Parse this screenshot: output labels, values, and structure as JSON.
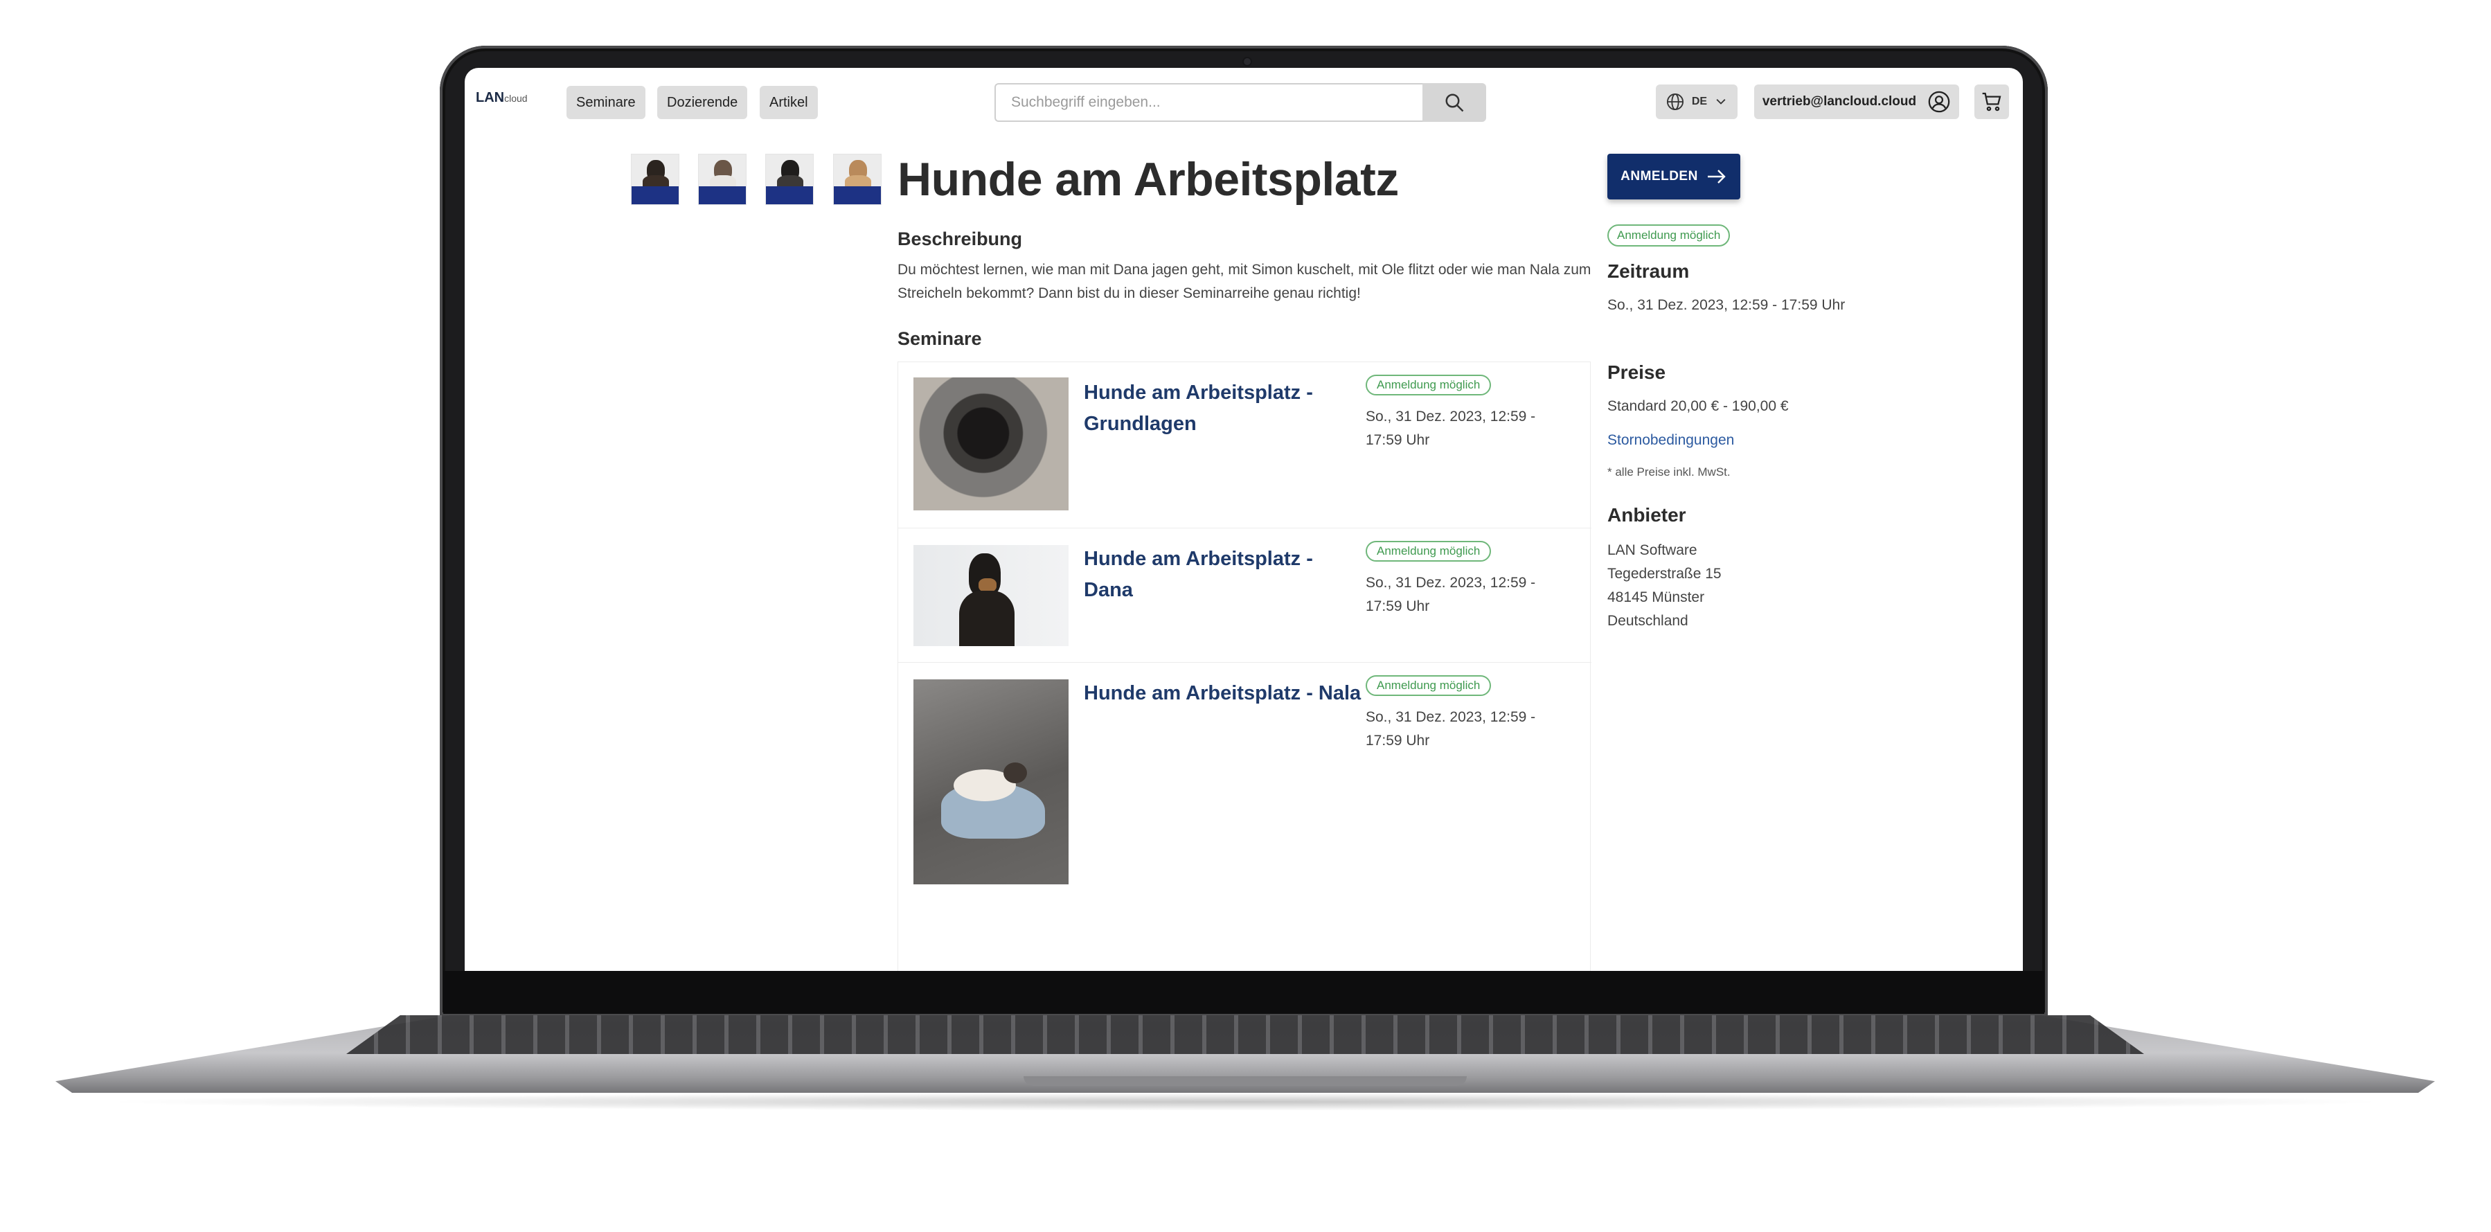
{
  "header": {
    "logo_main": "LAN",
    "logo_sub": "cloud",
    "nav": [
      "Seminare",
      "Dozierende",
      "Artikel"
    ],
    "search_placeholder": "Suchbegriff eingeben...",
    "language": "DE",
    "user_email": "vertrieb@lancloud.cloud",
    "icons": {
      "search": "search-icon",
      "language": "globe-icon",
      "dropdown": "chevron-down-icon",
      "user": "user-circle-icon",
      "cart": "cart-icon"
    }
  },
  "page": {
    "title": "Hunde am Arbeitsplatz",
    "description_heading": "Beschreibung",
    "description": "Du möchtest lernen, wie man mit Dana jagen geht, mit Simon kuschelt, mit Ole flitzt oder wie man Nala zum Streicheln bekommt? Dann bist du in dieser Seminarreihe genau richtig!",
    "seminars_heading": "Seminare"
  },
  "seminars": [
    {
      "title": "Hunde am Arbeitsplatz - Grundlagen",
      "status": "Anmeldung möglich",
      "date": "So., 31 Dez. 2023, 12:59 - 17:59  Uhr"
    },
    {
      "title": "Hunde am Arbeitsplatz - Dana",
      "status": "Anmeldung möglich",
      "date": "So., 31 Dez. 2023, 12:59 - 17:59  Uhr"
    },
    {
      "title": "Hunde am Arbeitsplatz - Nala",
      "status": "Anmeldung möglich",
      "date": "So., 31 Dez. 2023, 12:59 - 17:59  Uhr"
    }
  ],
  "sidebar": {
    "cta_label": "ANMELDEN",
    "status": "Anmeldung möglich",
    "period_heading": "Zeitraum",
    "period": "So., 31 Dez. 2023, 12:59 - 17:59 Uhr",
    "prices_heading": "Preise",
    "prices": "Standard 20,00 € - 190,00 €",
    "cancellation_link": "Stornobedingungen",
    "vat_note": "* alle Preise inkl. MwSt.",
    "provider_heading": "Anbieter",
    "provider_lines": [
      "LAN Software",
      "Tegederstraße 15",
      "48145 Münster",
      "Deutschland"
    ]
  },
  "colors": {
    "primary": "#112e6b",
    "link": "#1f3a6a",
    "status_green": "#3f9a4f",
    "thumb_band": "#1d3284"
  }
}
